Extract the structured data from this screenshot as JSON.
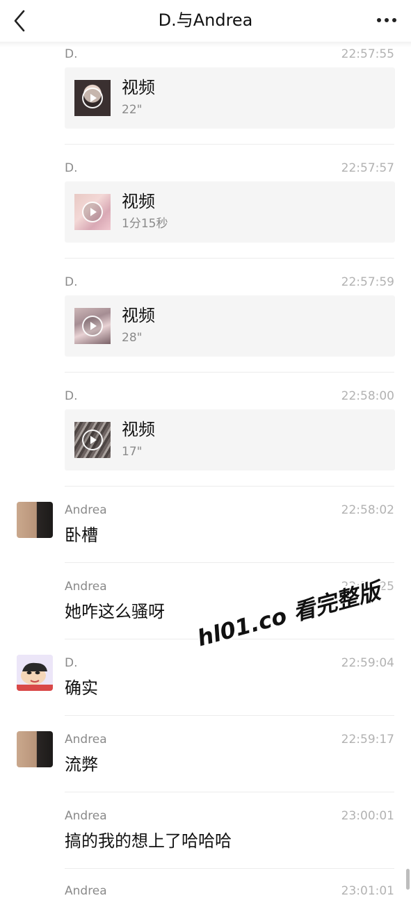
{
  "header": {
    "title": "D.与Andrea"
  },
  "messages": [
    {
      "sender": "D.",
      "time": "22:57:55",
      "video": {
        "label": "视频",
        "duration": "22\""
      }
    },
    {
      "sender": "D.",
      "time": "22:57:57",
      "video": {
        "label": "视频",
        "duration": "1分15秒"
      }
    },
    {
      "sender": "D.",
      "time": "22:57:59",
      "video": {
        "label": "视频",
        "duration": "28\""
      }
    },
    {
      "sender": "D.",
      "time": "22:58:00",
      "video": {
        "label": "视频",
        "duration": "17\""
      }
    },
    {
      "sender": "Andrea",
      "time": "22:58:02",
      "text": "卧槽"
    },
    {
      "sender": "Andrea",
      "time": "22:58:25",
      "text": "她咋这么骚呀"
    },
    {
      "sender": "D.",
      "time": "22:59:04",
      "text": "确实"
    },
    {
      "sender": "Andrea",
      "time": "22:59:17",
      "text": "流弊"
    },
    {
      "sender": "Andrea",
      "time": "23:00:01",
      "text": "搞的我的想上了哈哈哈"
    },
    {
      "sender": "Andrea",
      "time": "23:01:01"
    }
  ],
  "watermark": "hl01.co 看完整版",
  "colors": {
    "background": "#ffffff",
    "card": "#f5f5f5",
    "name": "#8a8a8a",
    "time": "#b2b2b2",
    "divider": "#ececec"
  }
}
